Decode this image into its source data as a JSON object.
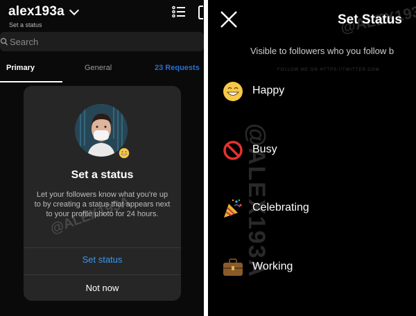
{
  "left": {
    "username": "alex193a",
    "status_subtitle": "Set a status",
    "search_placeholder": "Search",
    "tabs": {
      "primary": "Primary",
      "general": "General",
      "requests": "23 Requests"
    },
    "modal": {
      "title": "Set a status",
      "body": "Let your followers know what you're up to by creating a status that appears next to your profile photo for 24 hours.",
      "primary_button": "Set status",
      "secondary_button": "Not now"
    }
  },
  "right": {
    "title": "Set Status",
    "subtitle": "Visible to followers who you follow b",
    "statuses": [
      {
        "icon": "grinning-face-icon",
        "label": "Happy"
      },
      {
        "icon": "no-entry-icon",
        "label": "Busy"
      },
      {
        "icon": "party-popper-icon",
        "label": "Celebrating"
      },
      {
        "icon": "briefcase-icon",
        "label": "Working"
      }
    ]
  },
  "watermark": {
    "handle": "@ALEX193A",
    "small": "FOLLOW ME ON HTTPS://TWITTER.COM"
  },
  "colors": {
    "accent": "#3897f0",
    "requests": "#2a6ecf",
    "modal_bg": "#262626"
  }
}
